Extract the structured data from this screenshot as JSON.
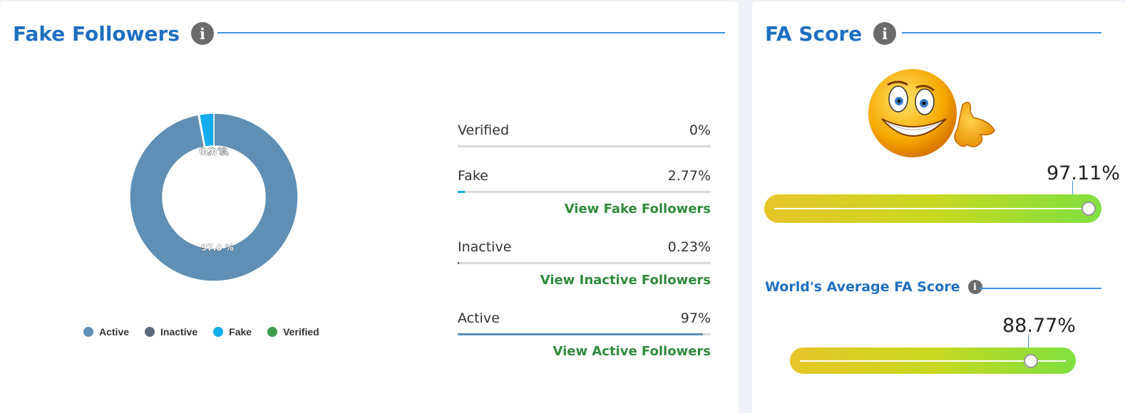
{
  "fake_followers": {
    "title": "Fake Followers",
    "info_icon": "info-icon",
    "chart_data": {
      "type": "pie",
      "categories": [
        "Active",
        "Inactive",
        "Fake",
        "Verified"
      ],
      "values": [
        97.0,
        0.23,
        2.77,
        0
      ],
      "slice_labels": [
        "97.0 %",
        "0.2 %",
        "2.8 %",
        "0.0 %"
      ],
      "colors": [
        "#5f8fb4",
        "#5a6a7e",
        "#12acef",
        "#3d9a4a"
      ],
      "legend_position": "bottom"
    },
    "legend": [
      {
        "label": "Active",
        "color": "#5f8fb4"
      },
      {
        "label": "Inactive",
        "color": "#5a6a7e"
      },
      {
        "label": "Fake",
        "color": "#12acef"
      },
      {
        "label": "Verified",
        "color": "#3d9a4a"
      }
    ],
    "stats": [
      {
        "label": "Verified",
        "value": "0%",
        "fill": 0,
        "color": "#3d9a4a",
        "link": ""
      },
      {
        "label": "Fake",
        "value": "2.77%",
        "fill": 0.0277,
        "color": "#12acef",
        "link": "View Fake Followers"
      },
      {
        "label": "Inactive",
        "value": "0.23%",
        "fill": 0.0023,
        "color": "#5a6a7e",
        "link": "View Inactive Followers"
      },
      {
        "label": "Active",
        "value": "97%",
        "fill": 0.97,
        "color": "#5f8fb4",
        "link": "View Active Followers"
      }
    ]
  },
  "fa_score": {
    "title": "FA Score",
    "info_icon": "info-icon",
    "emoji": "thumbs-up-smiley",
    "value": "97.11%",
    "level": 0.9711,
    "world_average": {
      "title": "World's Average FA Score",
      "info_icon": "info-icon",
      "value": "88.77%",
      "level": 0.8877
    }
  },
  "colors": {
    "heading": "#1f6fc0",
    "link": "#2e8b3a",
    "rule": "#3f93e0"
  }
}
